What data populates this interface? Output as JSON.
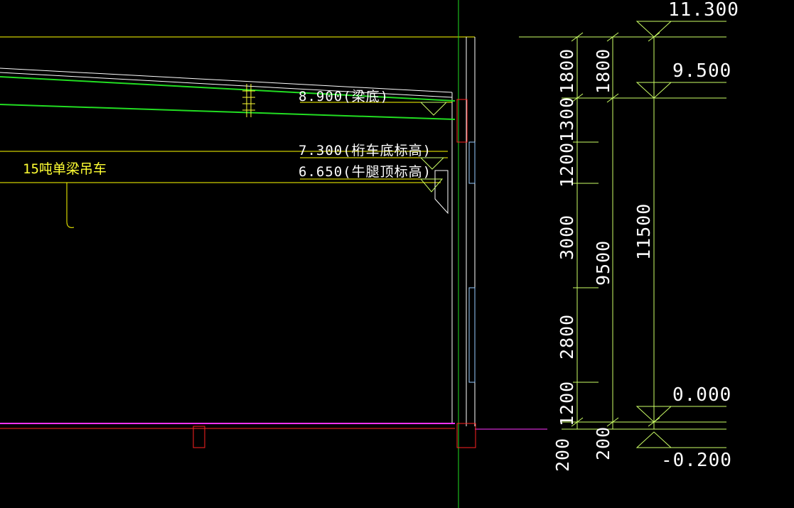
{
  "drawing": {
    "background": "#000000",
    "colors": {
      "primary": "#ffffff",
      "roof": "#22dd22",
      "dimension": "#ccff66",
      "construction": "#ffff00",
      "foundation": "#ff2222",
      "slab": "#ff33ff",
      "crane_label": "#ffff33",
      "window": "#99ccff"
    },
    "crane_label": "15吨单梁吊车",
    "annotations": {
      "beam_bottom": "8.900(梁底)",
      "crane_bottom": "7.300(桁车底标高)",
      "corbel_top": "6.650(牛腿顶标高)"
    },
    "elevations": {
      "top": "11.300",
      "eave": "9.500",
      "ground": "0.000",
      "foundation": "-0.200"
    },
    "dimensions_inner": [
      "1800",
      "1300",
      "1200",
      "3000",
      "2800",
      "1200",
      "200"
    ],
    "dimensions_middle": [
      "1800",
      "9500",
      "200"
    ],
    "dimensions_outer": [
      "11500"
    ]
  }
}
